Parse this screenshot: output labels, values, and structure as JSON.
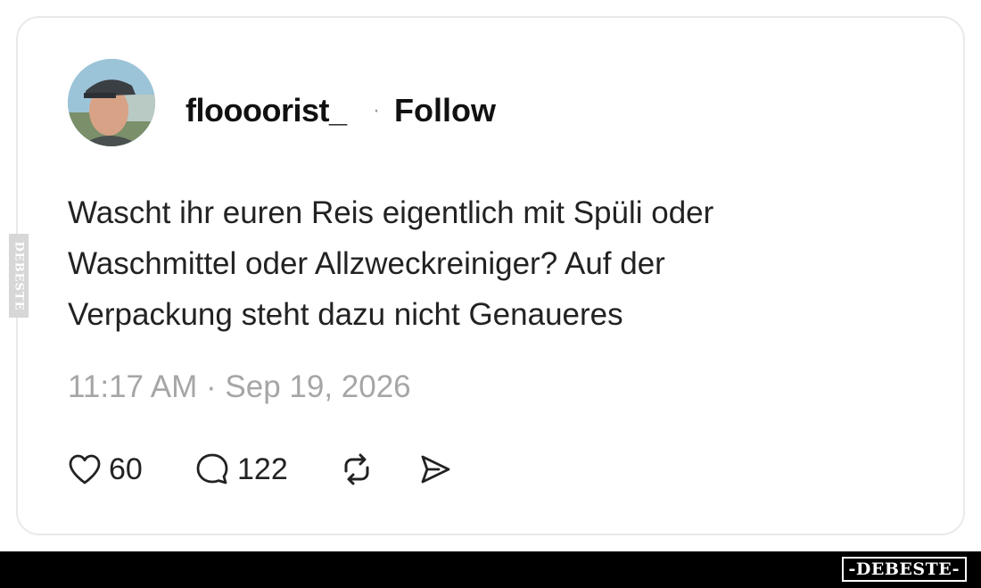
{
  "post": {
    "username": "floooorist_",
    "separator": "·",
    "follow_label": "Follow",
    "text_lines": [
      "Wascht ihr euren Reis eigentlich mit Spüli oder",
      "Waschmittel oder Allzweckreiniger? Auf der",
      "Verpackung steht dazu nicht Genaueres"
    ],
    "timestamp": "11:17 AM · Sep 19, 2026",
    "likes": "60",
    "replies": "122"
  },
  "icons": {
    "like": "heart-icon",
    "reply": "comment-bubble-icon",
    "repost": "repost-icon",
    "share": "send-icon"
  },
  "watermark": {
    "side": "DEBESTE",
    "footer": "-DEBESTE-"
  }
}
